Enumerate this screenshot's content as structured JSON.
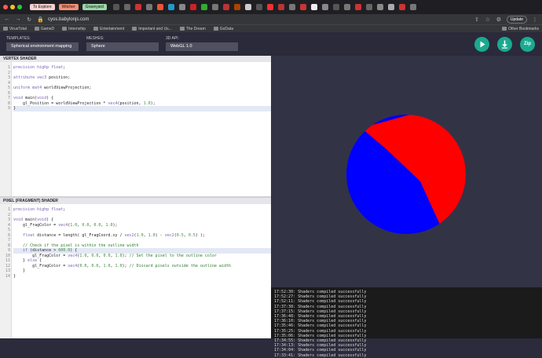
{
  "browser": {
    "tabs": [
      {
        "label": "To Explore",
        "color": "#f3d1cf"
      },
      {
        "label": "Witcher",
        "color": "#f08f76"
      },
      {
        "label": "Graveyard",
        "color": "#9cd6a8"
      }
    ],
    "url": "cyos.babylonjs.com",
    "update_label": "Update",
    "bookmarks": [
      "VirusTotal",
      "GameD",
      "Internship",
      "Entertainment",
      "Important and Us...",
      "The Dream",
      "GoData"
    ],
    "other_bookmarks": "Other Bookmarks"
  },
  "header": {
    "templates_label": "TEMPLATES:",
    "templates_value": "Spherical environment mapping",
    "meshes_label": "MESHES:",
    "meshes_value": "Sphere",
    "api_label": "3D API:",
    "api_value": "WebGL 1.0",
    "zip_label": "Zip",
    "accent": "#1aaa8f"
  },
  "vertex": {
    "title": "VERTEX SHADER",
    "lines": [
      "precision highp float;",
      "",
      "attribute vec3 position;",
      "",
      "uniform mat4 worldViewProjection;",
      "",
      "void main(void) {",
      "    gl_Position = worldViewProjection * vec4(position, 1.0);",
      "}"
    ]
  },
  "fragment": {
    "title": "PIXEL (FRAGMENT) SHADER",
    "lines": [
      "precision highp float;",
      "",
      "void main(void) {",
      "    gl_FragColor = vec4(1.0, 0.0, 0.0, 1.0);",
      "",
      "    float distance = length( gl_FragCoord.xy / vec2(1.0, 1.0) - vec2(0.5, 0.5) );",
      "",
      "    // Check if the pixel is within the outline width",
      "    if (distance > 600.0) {",
      "        gl_FragColor = vec4(1.0, 0.0, 0.0, 1.0); // Set the pixel to the outline color",
      "    } else {",
      "        gl_FragColor = vec4(0.0, 0.0, 1.0, 1.0); // Discard pixels outside the outline width",
      "    }",
      "}"
    ]
  },
  "render": {
    "sphere_colors": {
      "top": "#ff0000",
      "bottom": "#0000ff"
    },
    "background": "#333346"
  },
  "console": {
    "lines": [
      "17:52:30: Shaders compiled successfully",
      "17:52:27: Shaders compiled successfully",
      "17:52:11: Shaders compiled successfully",
      "17:37:38: Shaders compiled successfully",
      "17:37:15: Shaders compiled successfully",
      "17:36:48: Shaders compiled successfully",
      "17:36:10: Shaders compiled successfully",
      "17:35:46: Shaders compiled successfully",
      "17:35:25: Shaders compiled successfully",
      "17:35:06: Shaders compiled successfully",
      "17:34:55: Shaders compiled successfully",
      "17:34:13: Shaders compiled successfully",
      "17:34:04: Shaders compiled successfully",
      "17:33:41: Shaders compiled successfully"
    ]
  }
}
